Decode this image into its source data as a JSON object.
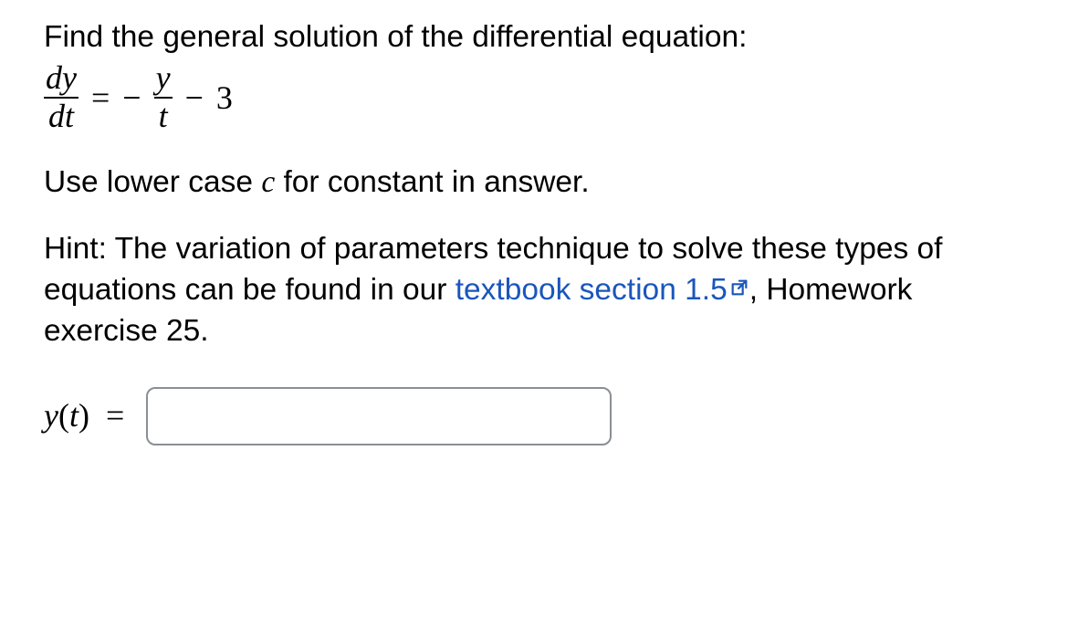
{
  "prompt": "Find the general solution of the differential equation:",
  "equation": {
    "lhs_num": "dy",
    "lhs_den": "dt",
    "eq": "=",
    "neg": "−",
    "rhs_num": "y",
    "rhs_den": "t",
    "minus": "−",
    "constant": "3"
  },
  "instruction_pre": "Use lower case ",
  "instruction_var": "c",
  "instruction_post": " for constant in answer.",
  "hint_pre": "Hint: The variation of parameters technique to solve these types of equations can be found in our ",
  "hint_link": "textbook section 1.5",
  "hint_post": ", Homework exercise 25.",
  "answer": {
    "y": "y",
    "open": "(",
    "t": "t",
    "close": ")",
    "eq": "=",
    "value": "",
    "placeholder": ""
  }
}
